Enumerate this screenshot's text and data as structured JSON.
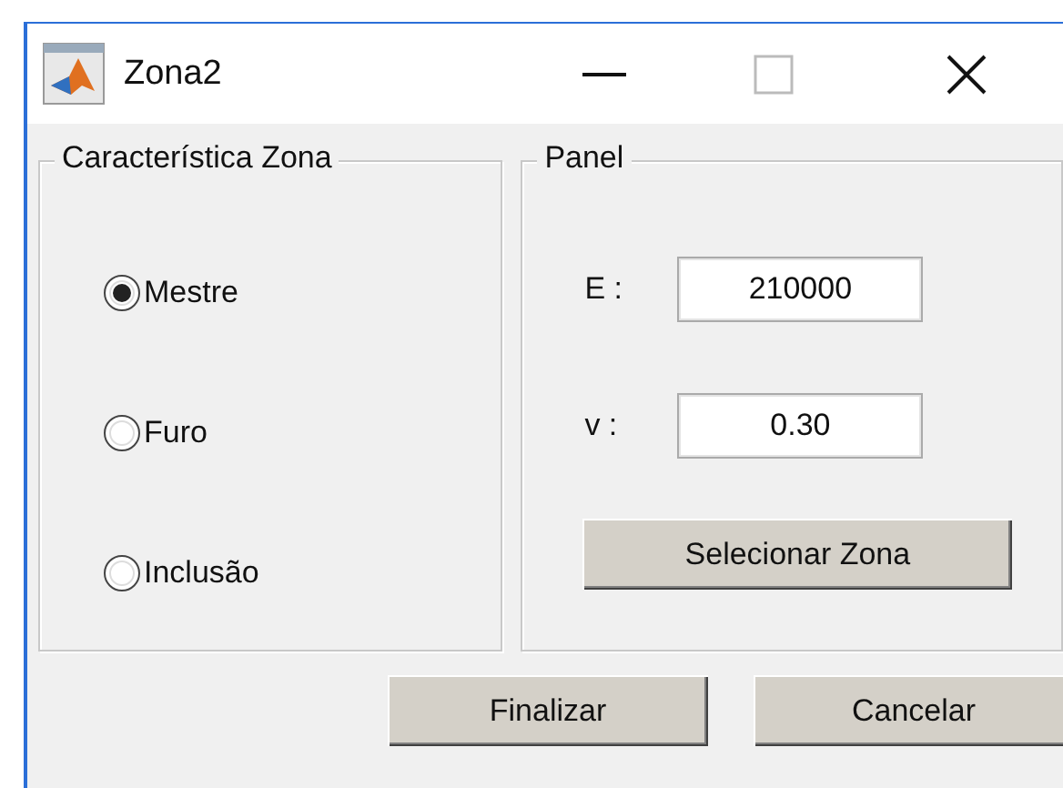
{
  "window": {
    "title": "Zona2"
  },
  "zone_group": {
    "title": "Característica Zona",
    "options": [
      {
        "label": "Mestre",
        "selected": true
      },
      {
        "label": "Furo",
        "selected": false
      },
      {
        "label": "Inclusão",
        "selected": false
      }
    ]
  },
  "panel": {
    "title": "Panel",
    "fields": [
      {
        "label": "E :",
        "value": "210000"
      },
      {
        "label": "v :",
        "value": "0.30"
      }
    ],
    "button": "Selecionar Zona"
  },
  "buttons": [
    "Finalizar",
    "Cancelar"
  ]
}
